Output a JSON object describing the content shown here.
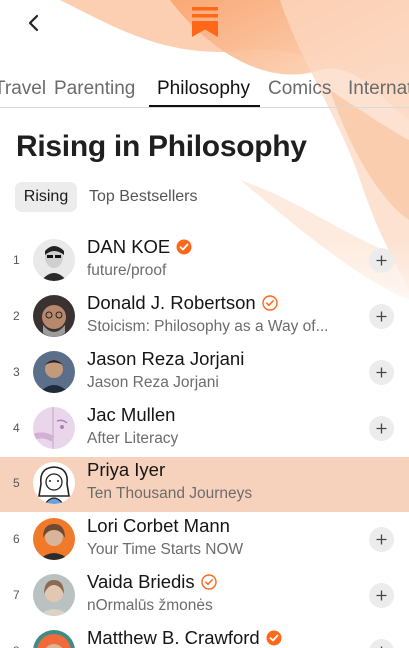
{
  "header": {
    "back_icon": "chevron-left-icon",
    "logo_icon": "substack-logo-icon",
    "brand_color": "#ff6719"
  },
  "tabs": [
    {
      "label": "Travel"
    },
    {
      "label": "Parenting"
    },
    {
      "label": "Philosophy",
      "active": true
    },
    {
      "label": "Comics"
    },
    {
      "label": "International"
    }
  ],
  "page_title": "Rising in Philosophy",
  "filters": {
    "selected": "Rising",
    "other": "Top Bestsellers"
  },
  "list": [
    {
      "rank": "1",
      "name": "DAN KOE",
      "subtitle": "future/proof",
      "badge": "filled"
    },
    {
      "rank": "2",
      "name": "Donald J. Robertson",
      "subtitle": "Stoicism: Philosophy as a Way of...",
      "badge": "outline"
    },
    {
      "rank": "3",
      "name": "Jason Reza Jorjani",
      "subtitle": "Jason Reza Jorjani",
      "badge": "none"
    },
    {
      "rank": "4",
      "name": "Jac Mullen",
      "subtitle": "After Literacy",
      "badge": "none"
    },
    {
      "rank": "5",
      "name": "Priya Iyer",
      "subtitle": "Ten Thousand Journeys",
      "badge": "none",
      "highlighted": true
    },
    {
      "rank": "6",
      "name": "Lori Corbet Mann",
      "subtitle": "Your Time Starts NOW",
      "badge": "none"
    },
    {
      "rank": "7",
      "name": "Vaida Briedis",
      "subtitle": "nOrmalūs žmonės",
      "badge": "outline"
    },
    {
      "rank": "8",
      "name": "Matthew B. Crawford",
      "subtitle": "",
      "badge": "filled"
    }
  ],
  "colors": {
    "highlight_row": "#f6d2bc",
    "badge": "#ff6719"
  }
}
